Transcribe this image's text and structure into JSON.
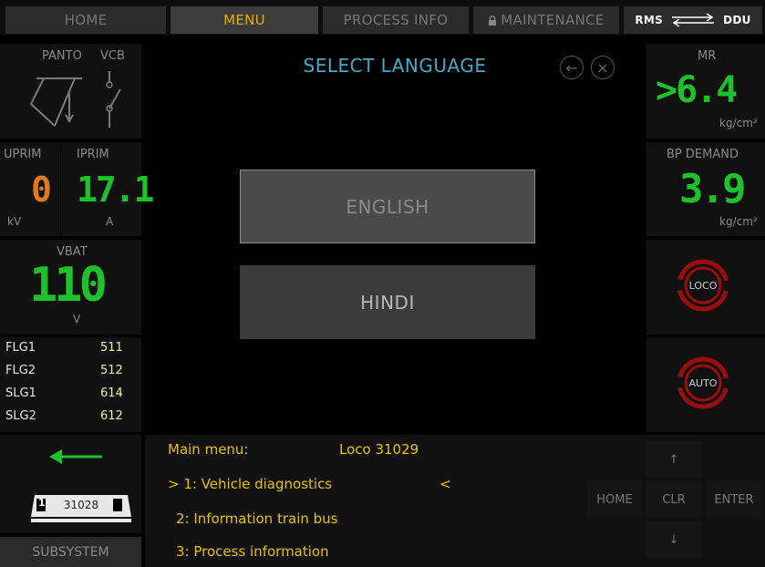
{
  "tabs": {
    "home": "HOME",
    "menu": "MENU",
    "process_info": "PROCESS INFO",
    "maintenance": "MAINTENANCE",
    "rms": "RMS",
    "ddu": "DDU"
  },
  "left": {
    "panto_label": "PANTO",
    "vcb_label": "VCB",
    "uprim_label": "UPRIM",
    "iprim_label": "IPRIM",
    "uprim_value": "0",
    "iprim_value": "17.1",
    "uprim_unit": "kV",
    "iprim_unit": "A",
    "vbat_label": "VBAT",
    "vbat_value": "110",
    "vbat_unit": "V",
    "flags": [
      {
        "name": "FLG1",
        "value": "511"
      },
      {
        "name": "FLG2",
        "value": "512"
      },
      {
        "name": "SLG1",
        "value": "614"
      },
      {
        "name": "SLG2",
        "value": "612"
      }
    ],
    "loco_number": "31028",
    "subsystem_label": "SUBSYSTEM"
  },
  "center": {
    "title": "SELECT LANGUAGE",
    "back_icon": "←",
    "close_icon": "×",
    "english": "ENGLISH",
    "hindi": "HINDI"
  },
  "right": {
    "mr_label": "MR",
    "mr_value": ">6.4",
    "mr_unit": "kg/cm²",
    "bp_label": "BP DEMAND",
    "bp_value": "3.9",
    "bp_unit": "kg/cm²",
    "loco_label": "LOCO",
    "auto_label": "AUTO"
  },
  "bottom": {
    "main_menu": "Main menu:",
    "loco": "Loco 31029",
    "item1": "> 1: Vehicle diagnostics",
    "item1_cursor": "<",
    "item2": "2: Information train bus",
    "item3": "3: Process information",
    "up": "↑",
    "down": "↓",
    "home": "HOME",
    "clr": "CLR",
    "enter": "ENTER"
  },
  "colors": {
    "accent_yellow": "#e6b000",
    "title_blue": "#49a7c7",
    "seg_green": "#1fc12a",
    "seg_orange": "#e07a16",
    "ring_red": "#9b0d0d"
  }
}
